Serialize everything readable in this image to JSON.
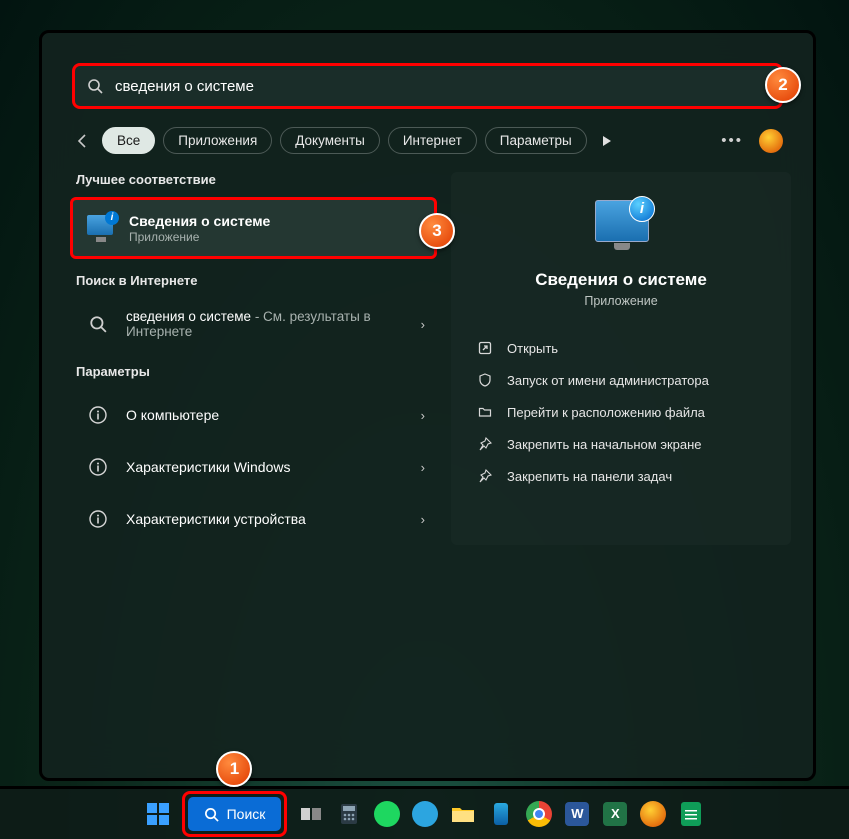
{
  "search": {
    "value": "сведения о системе"
  },
  "filters": {
    "all": "Все",
    "apps": "Приложения",
    "docs": "Документы",
    "web": "Интернет",
    "settings": "Параметры"
  },
  "left": {
    "best_match": "Лучшее соответствие",
    "result": {
      "title": "Сведения о системе",
      "sub": "Приложение"
    },
    "web_search": "Поиск в Интернете",
    "web_item": {
      "t1": "сведения о системе",
      "t2": " - См. результаты в Интернете"
    },
    "settings_h": "Параметры",
    "s1": "О компьютере",
    "s2": "Характеристики Windows",
    "s3": "Характеристики устройства"
  },
  "preview": {
    "title": "Сведения о системе",
    "sub": "Приложение",
    "open": "Открыть",
    "admin": "Запуск от имени администратора",
    "loc": "Перейти к расположению файла",
    "pin_start": "Закрепить на начальном экране",
    "pin_tb": "Закрепить на панели задач"
  },
  "taskbar": {
    "search": "Поиск"
  },
  "badges": {
    "b1": "1",
    "b2": "2",
    "b3": "3"
  }
}
